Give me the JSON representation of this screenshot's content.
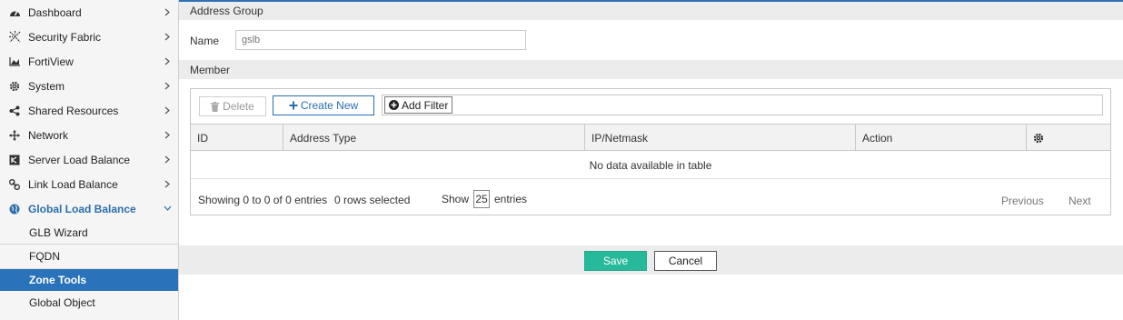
{
  "sidebar": {
    "items": [
      {
        "label": "Dashboard",
        "icon": "dashboard-icon"
      },
      {
        "label": "Security Fabric",
        "icon": "security-fabric-icon"
      },
      {
        "label": "FortiView",
        "icon": "fortiview-icon"
      },
      {
        "label": "System",
        "icon": "gear-icon"
      },
      {
        "label": "Shared Resources",
        "icon": "share-icon"
      },
      {
        "label": "Network",
        "icon": "network-arrows-icon"
      },
      {
        "label": "Server Load Balance",
        "icon": "server-load-balance-icon"
      },
      {
        "label": "Link Load Balance",
        "icon": "link-icon"
      },
      {
        "label": "Global Load Balance",
        "icon": "globe-icon",
        "active": true
      }
    ],
    "subitems": [
      {
        "label": "GLB Wizard"
      },
      {
        "label": "FQDN"
      },
      {
        "label": "Zone Tools",
        "selected": true
      },
      {
        "label": "Global Object"
      }
    ]
  },
  "form": {
    "section_title": "Address Group",
    "name_label": "Name",
    "name_value": "gslb",
    "member_title": "Member"
  },
  "toolbar": {
    "delete_label": "Delete",
    "create_label": "Create New",
    "filter_label": "Add Filter"
  },
  "table": {
    "columns": [
      "ID",
      "Address Type",
      "IP/Netmask",
      "Action"
    ],
    "empty_text": "No data available in table"
  },
  "footer": {
    "showing_text": "Showing 0 to 0 of 0 entries",
    "selected_text": "0 rows selected",
    "show_label": "Show",
    "page_size": "25",
    "entries_label": "entries",
    "previous_label": "Previous",
    "next_label": "Next"
  },
  "actions": {
    "save_label": "Save",
    "cancel_label": "Cancel"
  },
  "colors": {
    "accent": "#2a72b9",
    "save": "#26b99a",
    "active_text": "#2b6fab"
  }
}
